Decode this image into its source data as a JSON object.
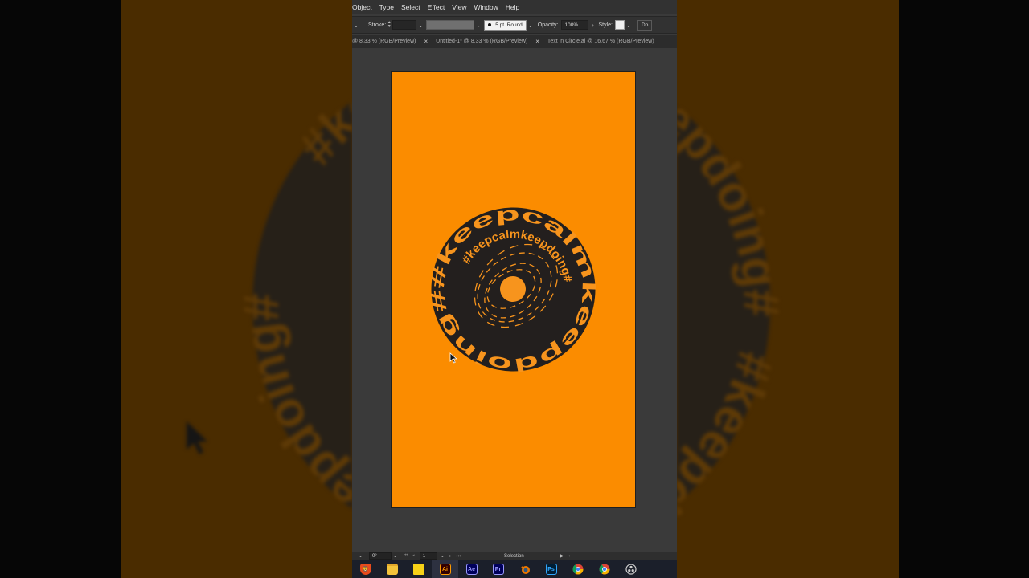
{
  "menu": {
    "items": [
      "Object",
      "Type",
      "Select",
      "Effect",
      "View",
      "Window",
      "Help"
    ]
  },
  "control_bar": {
    "stroke_label": "Stroke:",
    "brush_label": "5 pt. Round",
    "opacity_label": "Opacity:",
    "opacity_value": "100%",
    "style_label": "Style:",
    "doc_label": "Do"
  },
  "tabs": [
    {
      "label": "@ 8.33 % (RGB/Preview)"
    },
    {
      "label": "Untitled-1* @ 8.33 % (RGB/Preview)"
    },
    {
      "label": "Text in Circle.ai @ 16.67 % (RGB/Preview)"
    }
  ],
  "artwork": {
    "outer_text": "#keepcalmkeepdoing#",
    "background_text": "#keepdoing#",
    "colors": {
      "artboard": "#fb8c00",
      "badge": "#231f1e",
      "accent": "#f7941d"
    }
  },
  "status_bar": {
    "rotation": "0°",
    "page": "1",
    "tool": "Selection"
  },
  "taskbar": {
    "apps": [
      {
        "name": "brave-icon",
        "label": ""
      },
      {
        "name": "file-explorer-icon",
        "label": ""
      },
      {
        "name": "sticky-notes-icon",
        "label": ""
      },
      {
        "name": "illustrator-icon",
        "label": "Ai"
      },
      {
        "name": "after-effects-icon",
        "label": "Ae"
      },
      {
        "name": "premiere-icon",
        "label": "Pr"
      },
      {
        "name": "blender-icon",
        "label": ""
      },
      {
        "name": "photoshop-icon",
        "label": "Ps"
      },
      {
        "name": "chrome-icon",
        "label": ""
      },
      {
        "name": "chrome-alt-icon",
        "label": ""
      },
      {
        "name": "obs-icon",
        "label": ""
      }
    ]
  }
}
